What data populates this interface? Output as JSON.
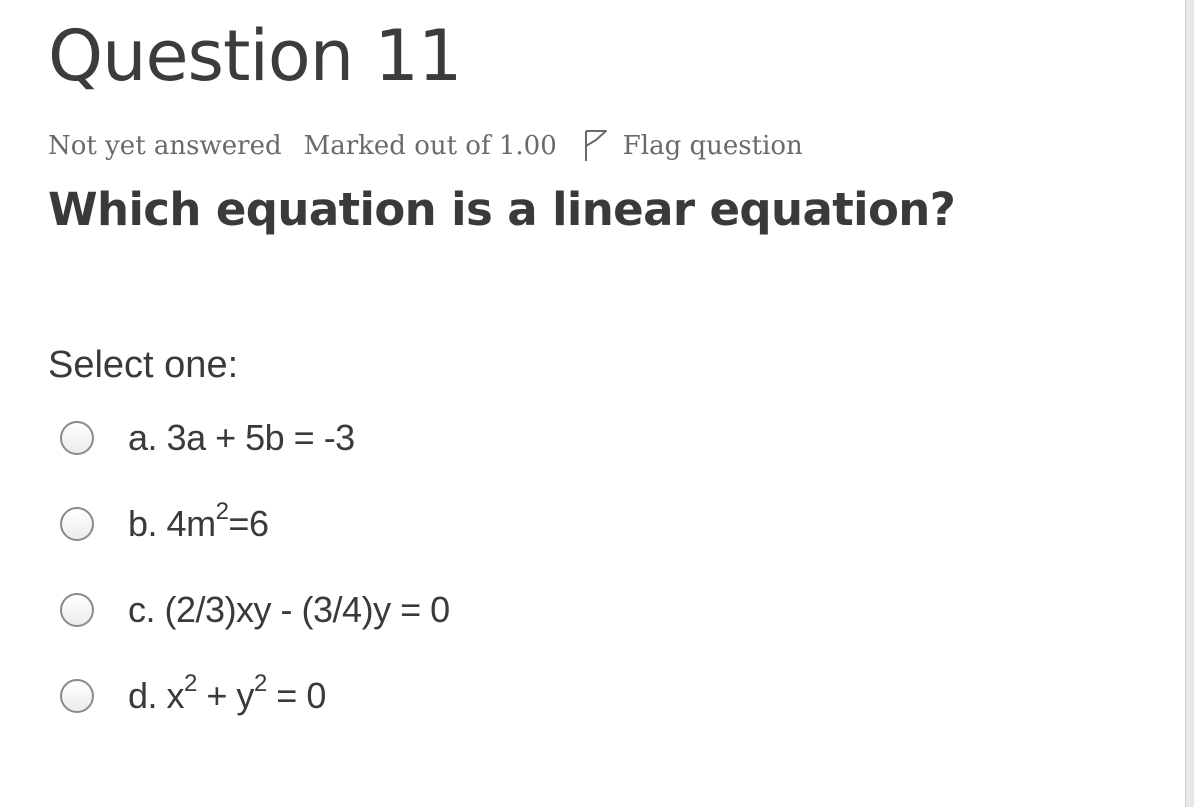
{
  "question": {
    "title": "Question 11",
    "status": "Not yet answered",
    "marks": "Marked out of 1.00",
    "flag_label": "Flag question",
    "text": "Which equation is a linear equation?",
    "prompt": "Select one:"
  },
  "answers": [
    {
      "letter": "a.",
      "parts": [
        "3a + 5b = -3"
      ]
    },
    {
      "letter": "b.",
      "parts": [
        "4m",
        "2",
        "=6"
      ]
    },
    {
      "letter": "c.",
      "parts": [
        "(2/3)xy - (3/4)y = 0"
      ]
    },
    {
      "letter": "d.",
      "parts": [
        "x",
        "2",
        " + y",
        "2",
        " = 0"
      ]
    }
  ],
  "icons": {
    "flag": "flag-outline-icon",
    "radio": "radio-unchecked-icon"
  },
  "colors": {
    "heading": "#3c3c3c",
    "info": "#6a6a6a",
    "radio_border": "#8a8a8a"
  }
}
